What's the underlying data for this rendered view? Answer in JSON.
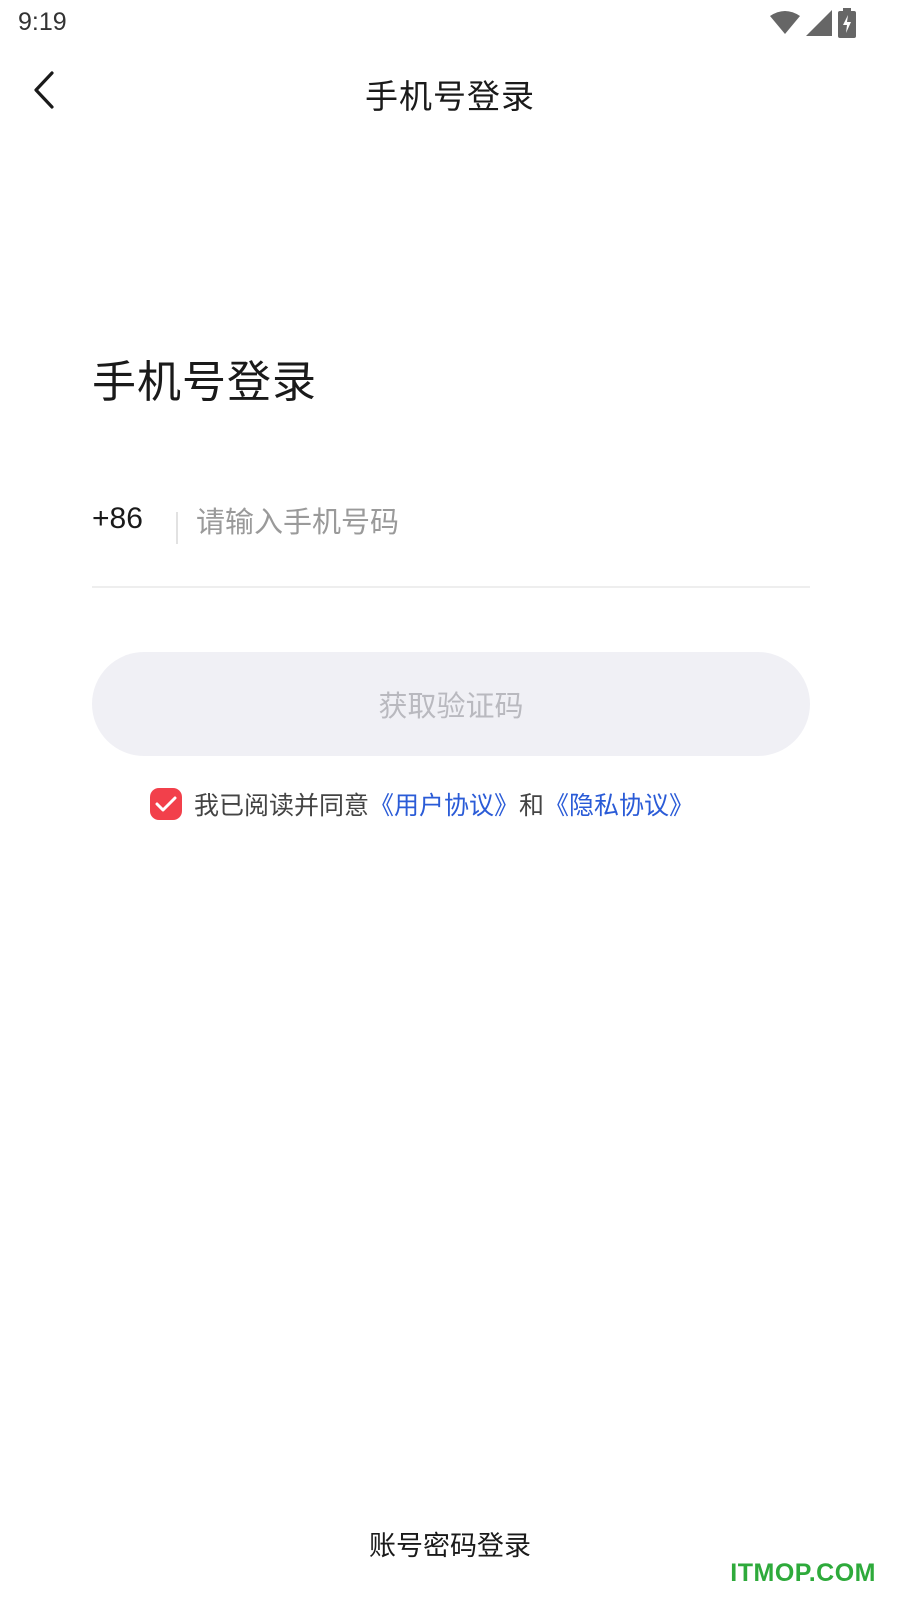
{
  "status_bar": {
    "time": "9:19",
    "icons": [
      "wifi-icon",
      "signal-icon",
      "battery-charging-icon"
    ]
  },
  "nav": {
    "back_icon": "chevron-left-icon",
    "title": "手机号登录"
  },
  "main": {
    "heading": "手机号登录",
    "country_code": "+86",
    "phone_placeholder": "请输入手机号码",
    "phone_value": "",
    "get_code_label": "获取验证码"
  },
  "agreement": {
    "checked": true,
    "prefix": "我已阅读并同意",
    "user_agreement": "《用户协议》",
    "conjunction": "和",
    "privacy_agreement": "《隐私协议》"
  },
  "footer": {
    "alt_login_label": "账号密码登录"
  },
  "watermark": "ITMOP.COM",
  "colors": {
    "accent_red": "#f2404b",
    "link_blue": "#2a5bd7",
    "button_bg": "#f0f0f5",
    "button_text_disabled": "#b9b9bf",
    "watermark_green": "#2eaa3b"
  }
}
